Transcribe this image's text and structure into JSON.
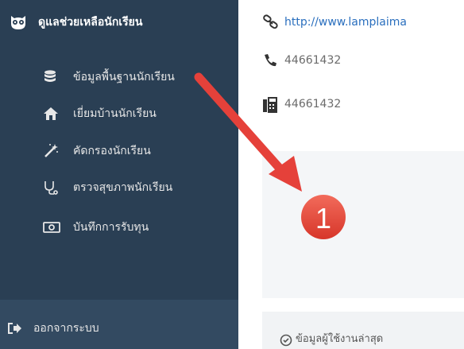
{
  "sidebar": {
    "header": {
      "title": "ดูแลช่วยเหลือนักเรียน",
      "icon": "owl-icon"
    },
    "items": [
      {
        "label": "ข้อมูลพื้นฐานนักเรียน",
        "icon": "database-icon"
      },
      {
        "label": "เยี่ยมบ้านนักเรียน",
        "icon": "home-icon"
      },
      {
        "label": "คัดกรองนักเรียน",
        "icon": "magic-wand-icon"
      },
      {
        "label": "ตรวจสุขภาพนักเรียน",
        "icon": "stethoscope-icon"
      },
      {
        "label": "บันทึกการรับทุน",
        "icon": "money-icon"
      }
    ],
    "logout": {
      "label": "ออกจากระบบ",
      "icon": "sign-out-icon"
    }
  },
  "contact": {
    "website": "http://www.lamplaima",
    "phone": "44661432",
    "fax": "44661432"
  },
  "footer": {
    "label": "ข้อมูลผู้ใช้งานล่าสุด",
    "icon": "clock-icon"
  },
  "annotation": {
    "number": "1",
    "color": "#e8473b"
  },
  "colors": {
    "sidebar_bg": "#2a3f54",
    "sidebar_text": "#e7e7e7",
    "link": "#2a6fbe"
  }
}
